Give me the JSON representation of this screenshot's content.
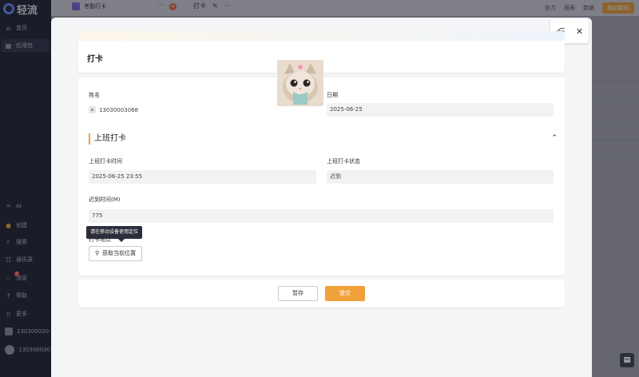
{
  "app": {
    "name": "轻流"
  },
  "sidebar": {
    "items": [
      {
        "label": "首页",
        "icon": "home-icon"
      },
      {
        "label": "应用包",
        "icon": "grid-icon"
      },
      {
        "label": "AI",
        "icon": "ai-icon"
      },
      {
        "label": "创建",
        "icon": "create-icon"
      },
      {
        "label": "搜索",
        "icon": "search-icon"
      },
      {
        "label": "通讯录",
        "icon": "contacts-icon"
      },
      {
        "label": "消息",
        "icon": "bell-icon",
        "badge": "2"
      },
      {
        "label": "帮助",
        "icon": "help-icon"
      },
      {
        "label": "更多",
        "icon": "more-icon"
      }
    ],
    "workspace": "130300030",
    "user": "130300030"
  },
  "topbar": {
    "tab_label": "考勤打卡",
    "more": "···",
    "page_title": "打卡",
    "right_items": [
      "协力",
      "报表",
      "数据"
    ],
    "publish_label": "发起新的"
  },
  "modal": {
    "header_title": "打卡",
    "fields": {
      "name_label": "姓名",
      "name_value": "13030003068",
      "date_label": "日期",
      "date_value": "2025-06-25"
    },
    "section": {
      "title": "上班打卡",
      "checkin_time_label": "上班打卡时间",
      "checkin_time_value": "2025-06-25 23:55",
      "checkin_status_label": "上班打卡状态",
      "checkin_status_value": "迟到",
      "late_label": "迟到时间(M)",
      "late_value": "775",
      "location_label": "打卡地点",
      "tooltip": "请在移动设备使用定位",
      "location_button": "获取当前位置"
    },
    "footer": {
      "save_label": "暂存",
      "submit_label": "提交"
    }
  },
  "colors": {
    "accent": "#f0a13a",
    "sidebar_bg": "#1f2130",
    "overlay": "#14161e"
  }
}
